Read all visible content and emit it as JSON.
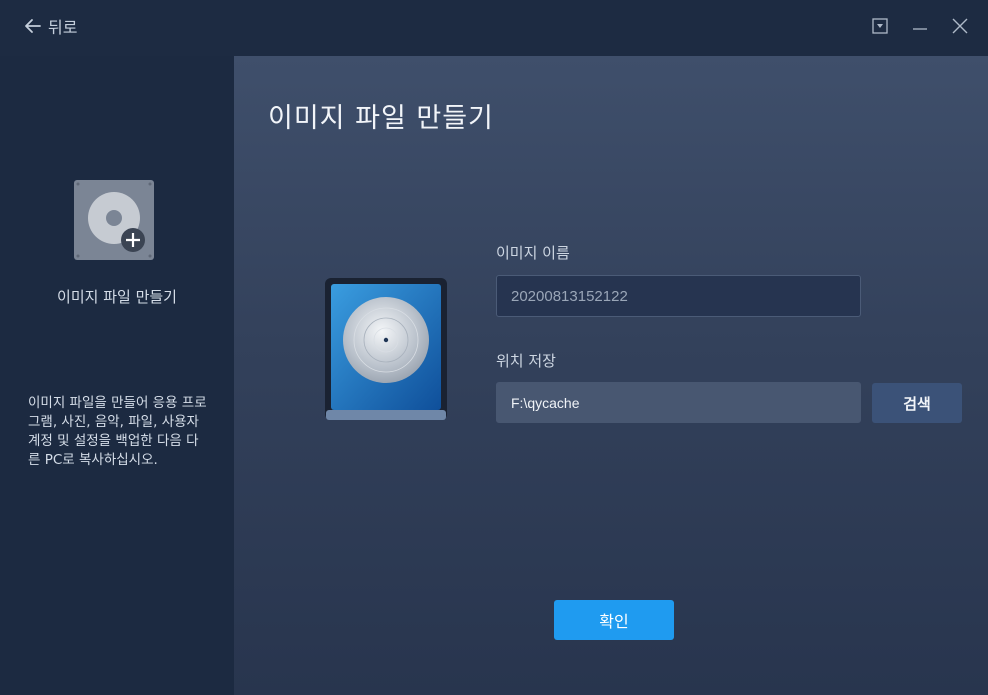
{
  "titlebar": {
    "back_label": "뒤로",
    "controls": [
      "dropdown-icon",
      "minimize-icon",
      "close-icon"
    ]
  },
  "sidebar": {
    "icon": "disk-image-add-icon",
    "title": "이미지 파일 만들기",
    "description": "이미지 파일을 만들어 응용 프로그램, 사진, 음악, 파일, 사용자 계정 및 설정을 백업한 다음 다른 PC로 복사하십시오."
  },
  "main": {
    "title": "이미지 파일 만들기",
    "image_name_label": "이미지 이름",
    "image_name_value": "20200813152122",
    "location_label": "위치 저장",
    "location_value": "F:\\qycache",
    "browse_label": "검색",
    "confirm_label": "확인"
  },
  "colors": {
    "accent": "#1f9bf0",
    "sidebar_bg": "#1c2a41",
    "main_bg": "#3f4f6b",
    "browse_bg": "#3b5278"
  }
}
